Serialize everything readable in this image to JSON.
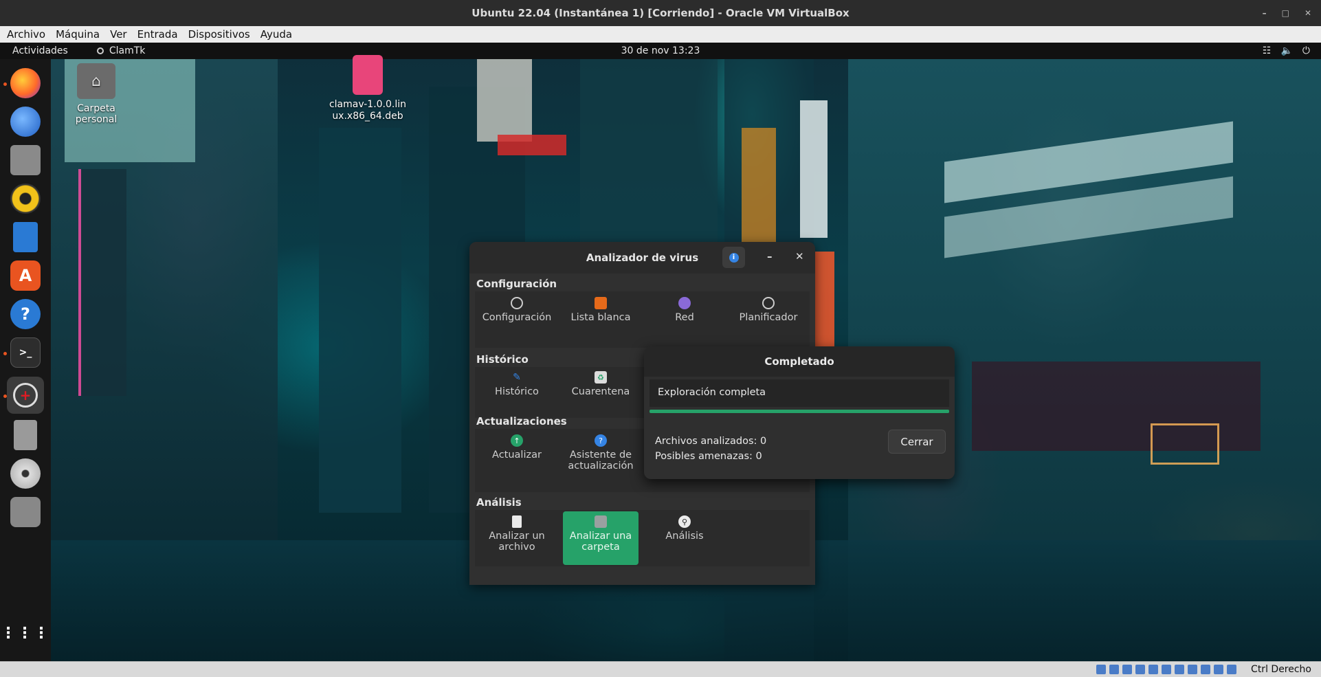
{
  "vbox": {
    "title": "Ubuntu 22.04 (Instantánea 1) [Corriendo] - Oracle VM VirtualBox",
    "menu": [
      "Archivo",
      "Máquina",
      "Ver",
      "Entrada",
      "Dispositivos",
      "Ayuda"
    ],
    "host_key": "Ctrl Derecho"
  },
  "topbar": {
    "activities": "Actividades",
    "app_name": "ClamTk",
    "clock": "30 de nov  13:23"
  },
  "desktop_icons": [
    {
      "label": "Carpeta personal",
      "icon": "home-folder-icon"
    },
    {
      "label": "clamav-1.0.0.linux.x86_64.deb",
      "icon": "deb-package-icon"
    }
  ],
  "dock": [
    {
      "name": "firefox-icon"
    },
    {
      "name": "thunderbird-icon"
    },
    {
      "name": "files-icon"
    },
    {
      "name": "rhythmbox-icon"
    },
    {
      "name": "libreoffice-writer-icon"
    },
    {
      "name": "ubuntu-software-icon"
    },
    {
      "name": "help-icon"
    },
    {
      "name": "terminal-icon"
    },
    {
      "name": "clamtk-icon"
    },
    {
      "name": "disk-utility-icon"
    },
    {
      "name": "optical-disc-icon"
    },
    {
      "name": "drive-icon"
    },
    {
      "name": "show-apps-icon"
    }
  ],
  "main_window": {
    "title": "Analizador de virus",
    "sections": {
      "config": "Configuración",
      "history": "Histórico",
      "updates": "Actualizaciones",
      "analysis": "Análisis"
    },
    "config_items": [
      "Configuración",
      "Lista blanca",
      "Red",
      "Planificador"
    ],
    "history_items": [
      "Histórico",
      "Cuarentena"
    ],
    "update_items": [
      "Actualizar",
      "Asistente de actualización"
    ],
    "analysis_items": [
      "Analizar un archivo",
      "Analizar una carpeta",
      "Análisis"
    ]
  },
  "dialog": {
    "title": "Completado",
    "status": "Exploración completa",
    "progress": 1.0,
    "files_scanned": "Archivos analizados: 0",
    "threats": "Posibles amenazas: 0",
    "close_label": "Cerrar"
  },
  "colors": {
    "accent_green": "#26a269",
    "ubuntu_orange": "#e95420",
    "info_blue": "#3584e4"
  }
}
